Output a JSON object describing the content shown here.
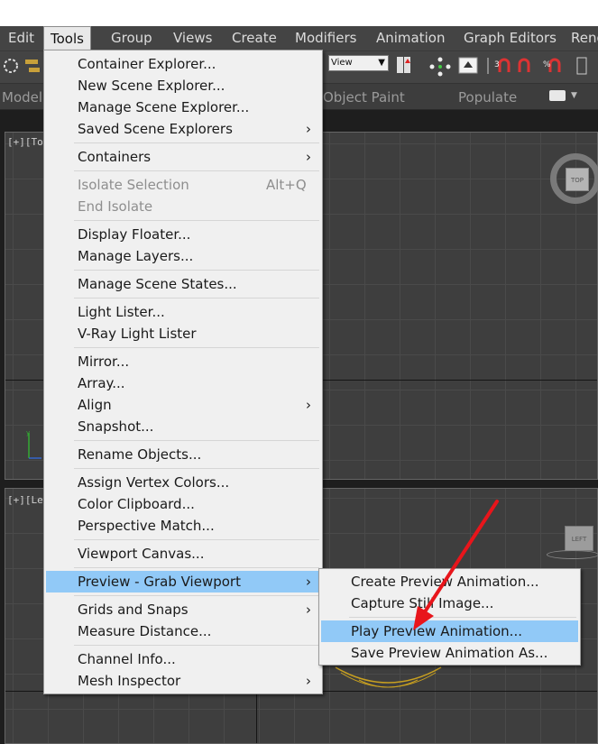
{
  "menubar": {
    "items": [
      "Edit",
      "Tools",
      "Group",
      "Views",
      "Create",
      "Modifiers",
      "Animation",
      "Graph Editors",
      "Rend"
    ],
    "active": "Tools"
  },
  "toolbar": {
    "view_select": "View"
  },
  "ribbon": {
    "tabs": [
      "Modeli",
      "Object Paint",
      "Populate"
    ]
  },
  "viewports": {
    "top_label": "[+][To",
    "left_label": "[+][Le",
    "top_cube": "TOP",
    "left_cube": "LEFT"
  },
  "tools_menu": {
    "items": [
      {
        "label": "Container Explorer..."
      },
      {
        "label": "New Scene Explorer..."
      },
      {
        "label": "Manage Scene Explorer..."
      },
      {
        "label": "Saved Scene Explorers",
        "submenu": true
      },
      {
        "label": "Containers",
        "submenu": true
      },
      {
        "label": "Isolate Selection",
        "shortcut": "Alt+Q",
        "disabled": true
      },
      {
        "label": "End Isolate",
        "disabled": true
      },
      {
        "label": "Display Floater..."
      },
      {
        "label": "Manage Layers..."
      },
      {
        "label": "Manage Scene States..."
      },
      {
        "label": "Light Lister..."
      },
      {
        "label": "V-Ray Light Lister"
      },
      {
        "label": "Mirror..."
      },
      {
        "label": "Array..."
      },
      {
        "label": "Align",
        "submenu": true
      },
      {
        "label": "Snapshot..."
      },
      {
        "label": "Rename Objects..."
      },
      {
        "label": "Assign Vertex Colors..."
      },
      {
        "label": "Color Clipboard..."
      },
      {
        "label": "Perspective Match..."
      },
      {
        "label": "Viewport Canvas..."
      },
      {
        "label": "Preview - Grab Viewport",
        "submenu": true,
        "highlighted": true
      },
      {
        "label": "Grids and Snaps",
        "submenu": true
      },
      {
        "label": "Measure Distance..."
      },
      {
        "label": "Channel Info..."
      },
      {
        "label": "Mesh Inspector",
        "submenu": true
      }
    ]
  },
  "preview_submenu": {
    "items": [
      {
        "label": "Create Preview Animation..."
      },
      {
        "label": "Capture Still Image..."
      },
      {
        "label": "Play Preview Animation...",
        "highlighted": true
      },
      {
        "label": "Save Preview Animation As..."
      }
    ]
  },
  "colors": {
    "menubar_bg": "#444444",
    "menu_bg": "#f0f0f0",
    "highlight": "#91c9f7",
    "annotation_arrow": "#e8151b"
  }
}
